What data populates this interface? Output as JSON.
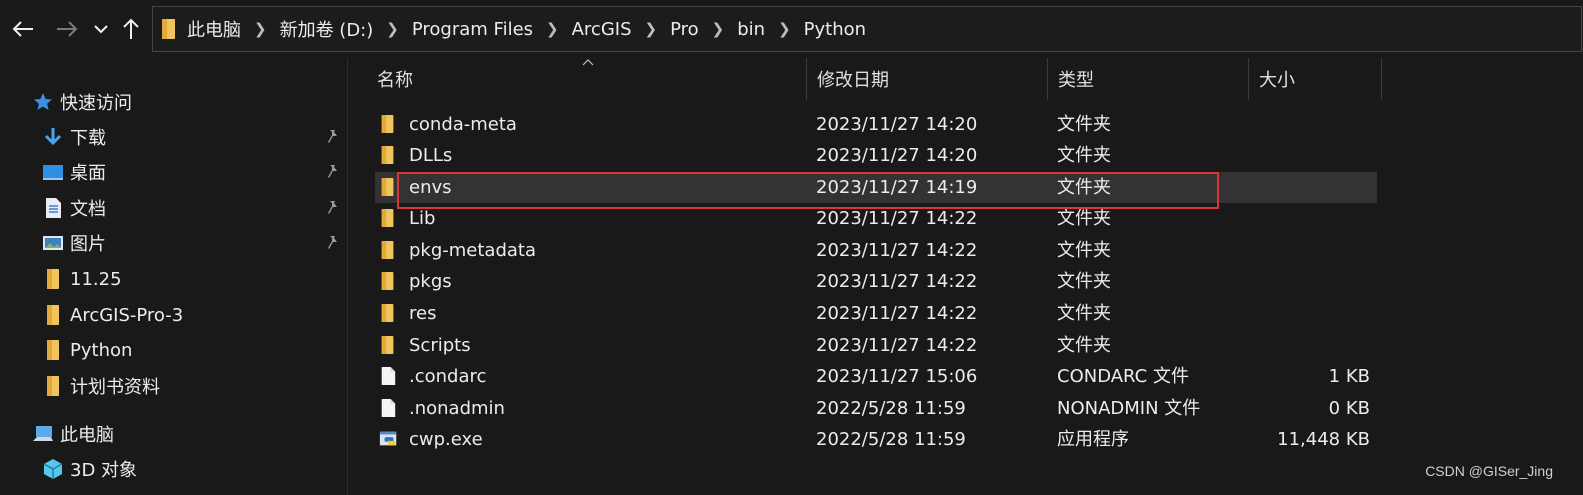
{
  "nav": {
    "back_icon": "arrow-left-icon",
    "forward_icon": "arrow-right-icon",
    "recent_icon": "chevron-down-icon",
    "up_icon": "arrow-up-icon"
  },
  "breadcrumb": [
    "此电脑",
    "新加卷 (D:)",
    "Program Files",
    "ArcGIS",
    "Pro",
    "bin",
    "Python"
  ],
  "sidebar": {
    "items": [
      {
        "label": "快速访问",
        "icon": "star-icon",
        "pinned": false
      },
      {
        "label": "下载",
        "icon": "download-icon",
        "pinned": true
      },
      {
        "label": "桌面",
        "icon": "desktop-icon",
        "pinned": true
      },
      {
        "label": "文档",
        "icon": "document-icon",
        "pinned": true
      },
      {
        "label": "图片",
        "icon": "pictures-icon",
        "pinned": true
      },
      {
        "label": "11.25",
        "icon": "folder-icon",
        "pinned": false
      },
      {
        "label": "ArcGIS-Pro-3",
        "icon": "folder-icon",
        "pinned": false
      },
      {
        "label": "Python",
        "icon": "folder-icon",
        "pinned": false
      },
      {
        "label": "计划书资料",
        "icon": "folder-icon",
        "pinned": false
      },
      {
        "label": "此电脑",
        "icon": "computer-icon",
        "pinned": false
      },
      {
        "label": "3D 对象",
        "icon": "3d-objects-icon",
        "pinned": false
      }
    ]
  },
  "columns": {
    "name": "名称",
    "modified": "修改日期",
    "type": "类型",
    "size": "大小"
  },
  "files": [
    {
      "name": "conda-meta",
      "modified": "2023/11/27 14:20",
      "type": "文件夹",
      "size": "",
      "icon": "folder-icon"
    },
    {
      "name": "DLLs",
      "modified": "2023/11/27 14:20",
      "type": "文件夹",
      "size": "",
      "icon": "folder-icon"
    },
    {
      "name": "envs",
      "modified": "2023/11/27 14:19",
      "type": "文件夹",
      "size": "",
      "icon": "folder-icon",
      "selected": true
    },
    {
      "name": "Lib",
      "modified": "2023/11/27 14:22",
      "type": "文件夹",
      "size": "",
      "icon": "folder-icon"
    },
    {
      "name": "pkg-metadata",
      "modified": "2023/11/27 14:22",
      "type": "文件夹",
      "size": "",
      "icon": "folder-icon"
    },
    {
      "name": "pkgs",
      "modified": "2023/11/27 14:22",
      "type": "文件夹",
      "size": "",
      "icon": "folder-icon"
    },
    {
      "name": "res",
      "modified": "2023/11/27 14:22",
      "type": "文件夹",
      "size": "",
      "icon": "folder-icon"
    },
    {
      "name": "Scripts",
      "modified": "2023/11/27 14:22",
      "type": "文件夹",
      "size": "",
      "icon": "folder-icon"
    },
    {
      "name": ".condarc",
      "modified": "2023/11/27 15:06",
      "type": "CONDARC 文件",
      "size": "1 KB",
      "icon": "file-icon"
    },
    {
      "name": ".nonadmin",
      "modified": "2022/5/28 11:59",
      "type": "NONADMIN 文件",
      "size": "0 KB",
      "icon": "file-icon"
    },
    {
      "name": "cwp.exe",
      "modified": "2022/5/28 11:59",
      "type": "应用程序",
      "size": "11,448 KB",
      "icon": "python-exe-icon"
    }
  ],
  "watermark": "CSDN @GISer_Jing",
  "colors": {
    "background": "#191919",
    "selected_row": "#333333",
    "highlight_border": "#d9343a",
    "folder": "#f2c55c",
    "quick_access_star": "#3a8ee6"
  }
}
